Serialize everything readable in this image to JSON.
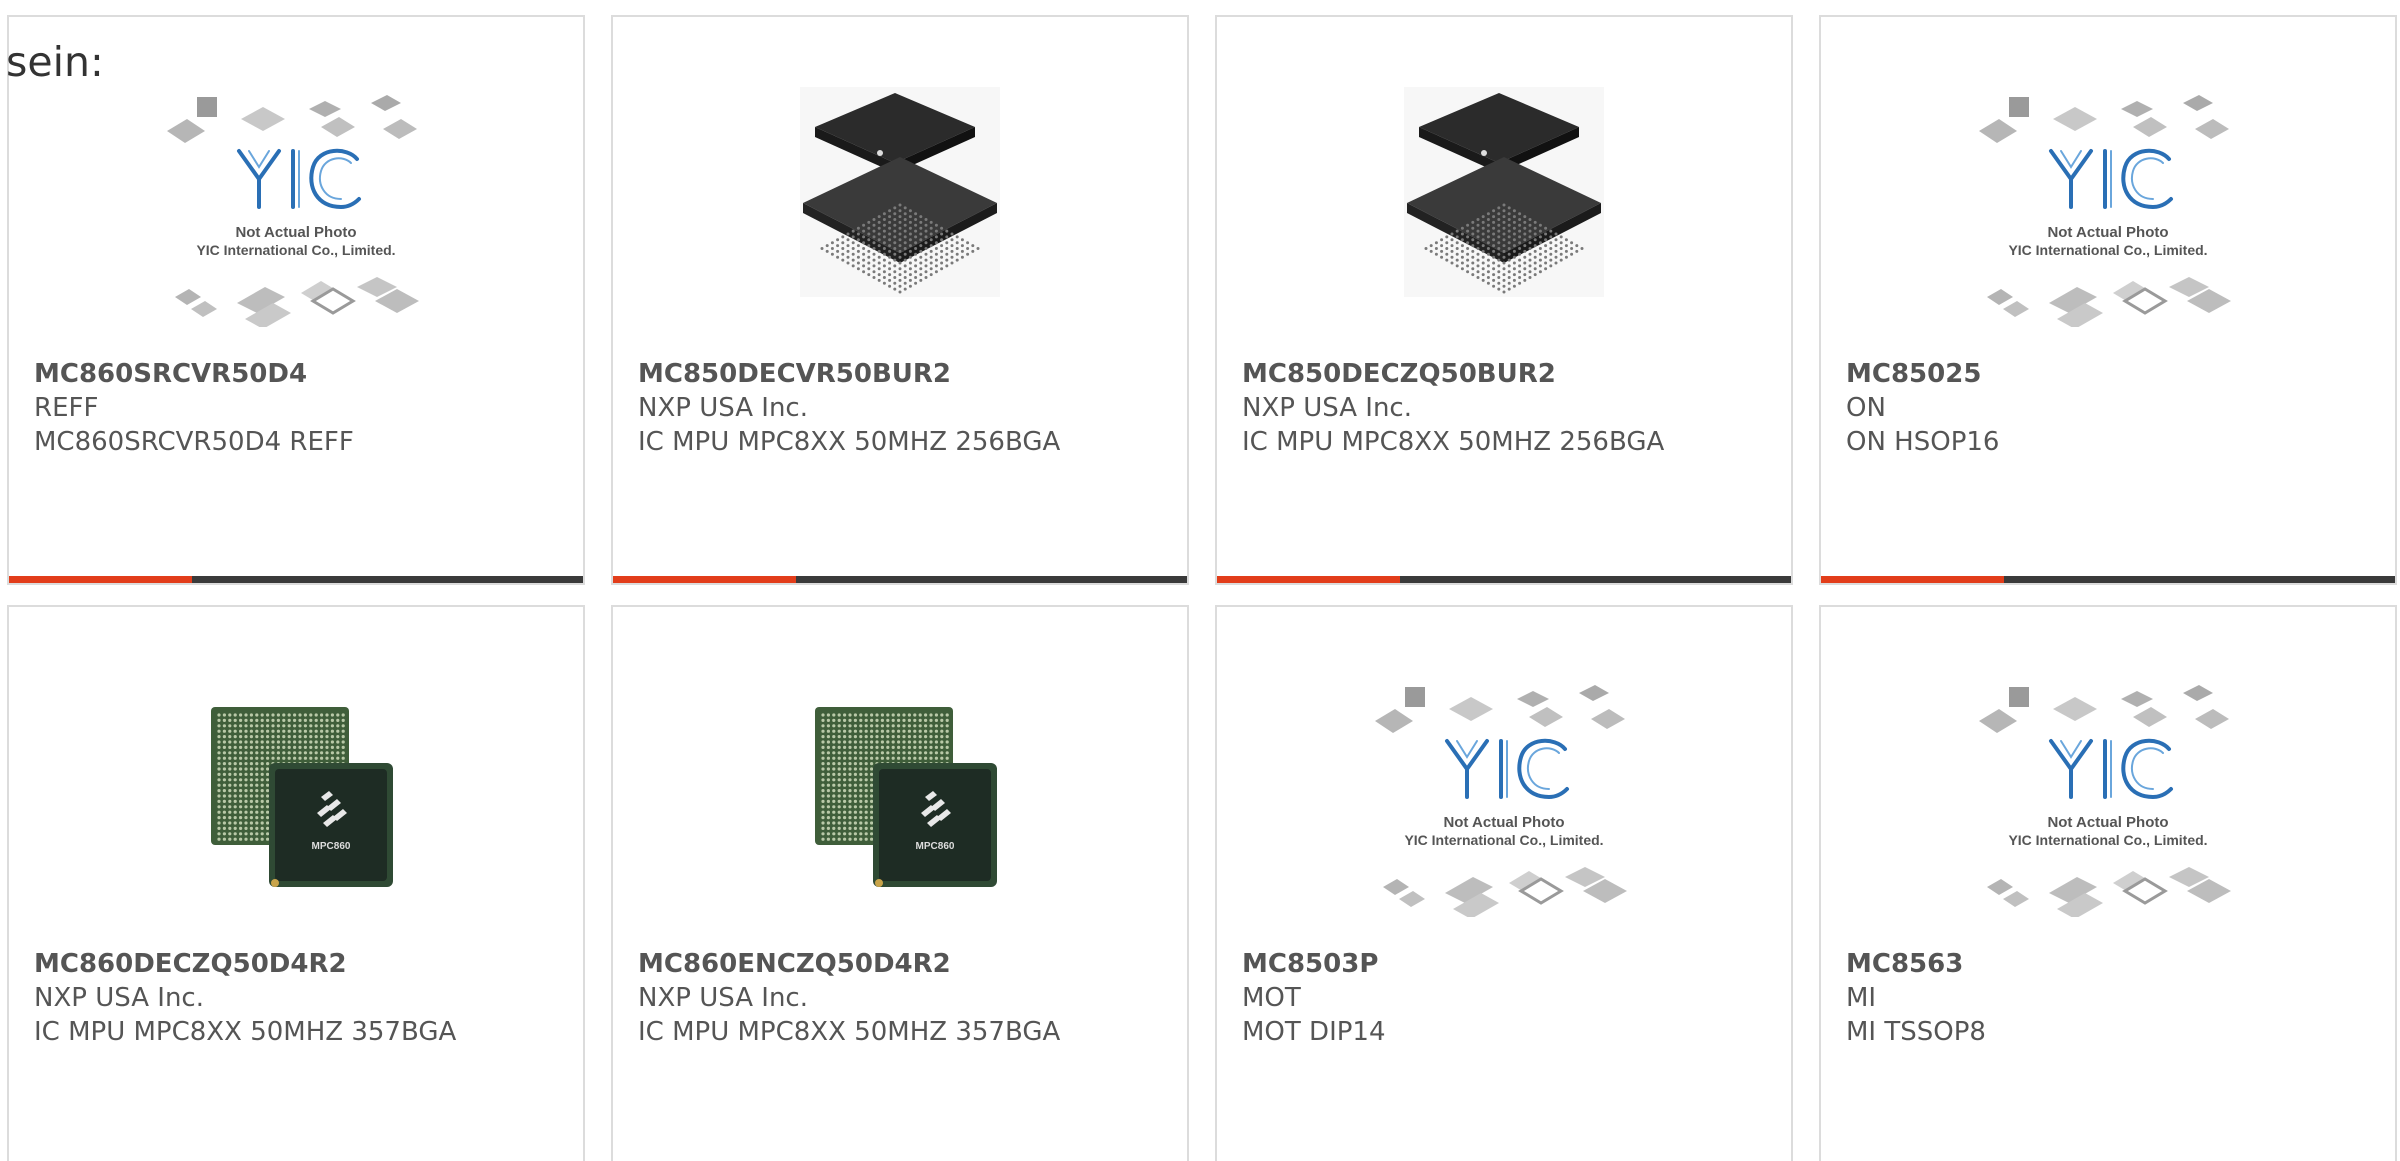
{
  "intro": "sein:",
  "colors": {
    "accent": "#e23d1a",
    "bar": "#3a3a3a",
    "border": "#dcdcdc",
    "text": "#555555"
  },
  "products": [
    {
      "part": "MC860SRCVR50D4",
      "maker": "REFF",
      "desc": "MC860SRCVR50D4 REFF",
      "image": "placeholder-photo",
      "placeholder_line1": "Not Actual Photo",
      "placeholder_line2": "YIC International Co., Limited.",
      "logo_text": "YIC"
    },
    {
      "part": "MC850DECVR50BUR2",
      "maker": "NXP USA Inc.",
      "desc": "IC MPU MPC8XX 50MHZ 256BGA",
      "image": "bga-chip-black"
    },
    {
      "part": "MC850DECZQ50BUR2",
      "maker": "NXP USA Inc.",
      "desc": "IC MPU MPC8XX 50MHZ 256BGA",
      "image": "bga-chip-black"
    },
    {
      "part": "MC85025",
      "maker": "ON",
      "desc": "ON HSOP16",
      "image": "placeholder-photo",
      "placeholder_line1": "Not Actual Photo",
      "placeholder_line2": "YIC International Co., Limited.",
      "logo_text": "YIC"
    },
    {
      "part": "MC860DECZQ50D4R2",
      "maker": "NXP USA Inc.",
      "desc": "IC MPU MPC8XX 50MHZ 357BGA",
      "image": "green-bga-chip",
      "chip_label": "MPC860"
    },
    {
      "part": "MC860ENCZQ50D4R2",
      "maker": "NXP USA Inc.",
      "desc": "IC MPU MPC8XX 50MHZ 357BGA",
      "image": "green-bga-chip",
      "chip_label": "MPC860"
    },
    {
      "part": "MC8503P",
      "maker": "MOT",
      "desc": "MOT DIP14",
      "image": "placeholder-photo",
      "placeholder_line1": "Not Actual Photo",
      "placeholder_line2": "YIC International Co., Limited.",
      "logo_text": "YIC"
    },
    {
      "part": "MC8563",
      "maker": "MI",
      "desc": "MI TSSOP8",
      "image": "placeholder-photo",
      "placeholder_line1": "Not Actual Photo",
      "placeholder_line2": "YIC International Co., Limited.",
      "logo_text": "YIC"
    }
  ]
}
